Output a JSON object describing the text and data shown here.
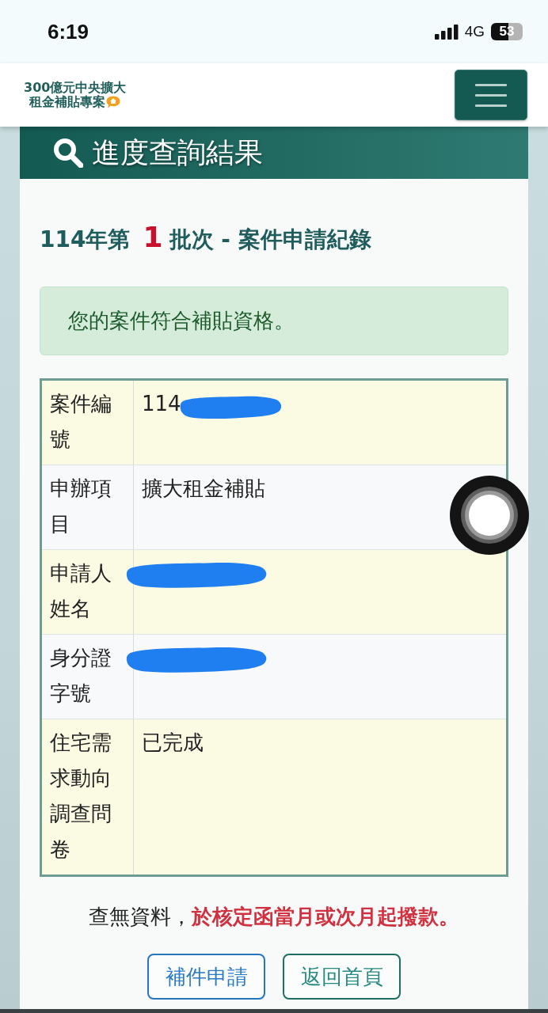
{
  "status_bar": {
    "time": "6:19",
    "network": "4G",
    "battery": "53"
  },
  "header": {
    "logo_lines": [
      "300億元中央擴大",
      "租金補貼專案"
    ]
  },
  "panel": {
    "title": "進度查詢結果"
  },
  "batch_title": {
    "prefix": "114年第",
    "number": "1",
    "suffix": "批次 - 案件申請紀錄"
  },
  "alert": {
    "text": "您的案件符合補貼資格。"
  },
  "table": {
    "rows": [
      {
        "label": "案件編號",
        "value": "114",
        "redacted": true
      },
      {
        "label": "申辦項目",
        "value": "擴大租金補貼",
        "redacted": false
      },
      {
        "label": "申請人姓名",
        "redacted": true
      },
      {
        "label": "身分證字號",
        "redacted": true
      },
      {
        "label": "住宅需求動向調查問卷",
        "value": "已完成",
        "redacted": false
      }
    ]
  },
  "note": "查無資料，**於核定函當月或次月起撥款。**",
  "buttons": [
    {
      "label": "補件申請",
      "kind": "primary"
    },
    {
      "label": "返回首頁",
      "kind": "secondary"
    }
  ]
}
